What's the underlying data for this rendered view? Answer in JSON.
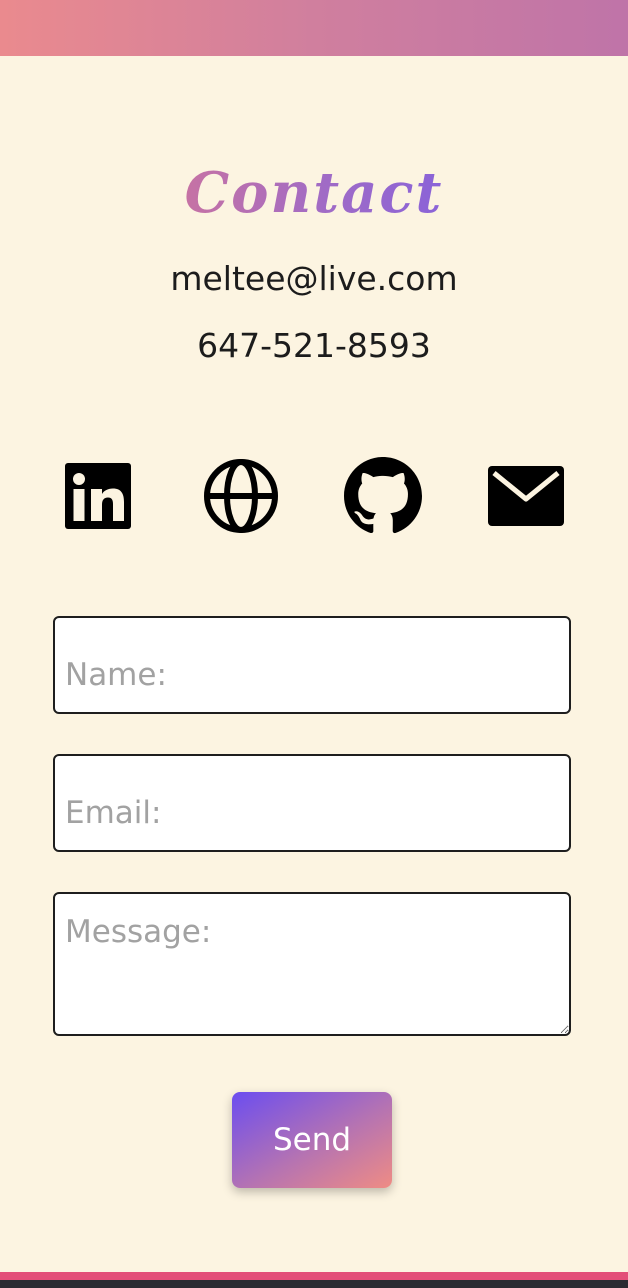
{
  "header": {
    "gradient_colors": [
      "#ea8a8e",
      "#bf74a8"
    ]
  },
  "contact": {
    "title": "Contact",
    "title_gradient": [
      "#c672a4",
      "#8a63d8"
    ],
    "email": "meltee@live.com",
    "phone": "647-521-8593"
  },
  "social_links": [
    {
      "icon": "linkedin-icon"
    },
    {
      "icon": "globe-icon"
    },
    {
      "icon": "github-icon"
    },
    {
      "icon": "mail-icon"
    }
  ],
  "form": {
    "name_placeholder": "Name:",
    "name_value": "",
    "email_placeholder": "Email:",
    "email_value": "",
    "message_placeholder": "Message:",
    "message_value": "",
    "send_label": "Send",
    "button_gradient": [
      "#6b4df0",
      "#ef8c84"
    ]
  },
  "footer": {
    "accent_color": "#e34e78",
    "bar_color": "#2a2a31"
  }
}
